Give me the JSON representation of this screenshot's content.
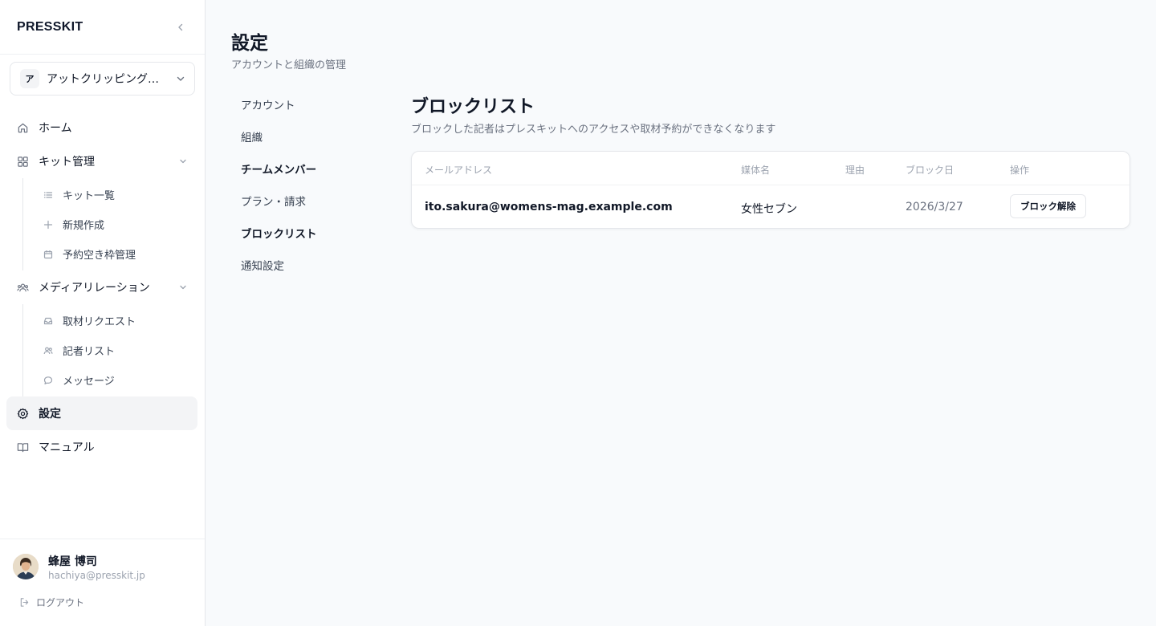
{
  "sidebar": {
    "logo": "PRESSKIT",
    "collapse_icon": "chevron-left-icon",
    "org": {
      "initial": "ア",
      "name": "アットクリッピング株式会社"
    },
    "nav": {
      "home": "ホーム",
      "kit_management": "キット管理",
      "kit_sub": {
        "kit_list": "キット一覧",
        "new": "新規作成",
        "slots": "予約空き枠管理"
      },
      "media_relations": "メディアリレーション",
      "media_sub": {
        "requests": "取材リクエスト",
        "journalists": "記者リスト",
        "messages": "メッセージ"
      },
      "settings": "設定",
      "manual": "マニュアル"
    },
    "user": {
      "name": "蜂屋 博司",
      "email": "hachiya@presskit.jp",
      "logout": "ログアウト"
    }
  },
  "main": {
    "title": "設定",
    "subtitle": "アカウントと組織の管理",
    "settings_nav": [
      "アカウント",
      "組織",
      "チームメンバー",
      "プラン・請求",
      "ブロックリスト",
      "通知設定"
    ],
    "section": {
      "title": "ブロックリスト",
      "description": "ブロックした記者はプレスキットへのアクセスや取材予約ができなくなります"
    },
    "table": {
      "headers": {
        "email": "メールアドレス",
        "media": "媒体名",
        "reason": "理由",
        "blocked_date": "ブロック日",
        "actions": "操作"
      },
      "rows": [
        {
          "email": "ito.sakura@womens-mag.example.com",
          "media": "女性セブン",
          "reason": "",
          "blocked_date": "2026/3/27",
          "action_label": "ブロック解除"
        }
      ]
    }
  },
  "colors": {
    "background": "#f8fafc",
    "sidebar": "#ffffff",
    "active_nav": "#f3f4f6",
    "text_primary": "#111827",
    "text_muted": "#6b7280"
  }
}
